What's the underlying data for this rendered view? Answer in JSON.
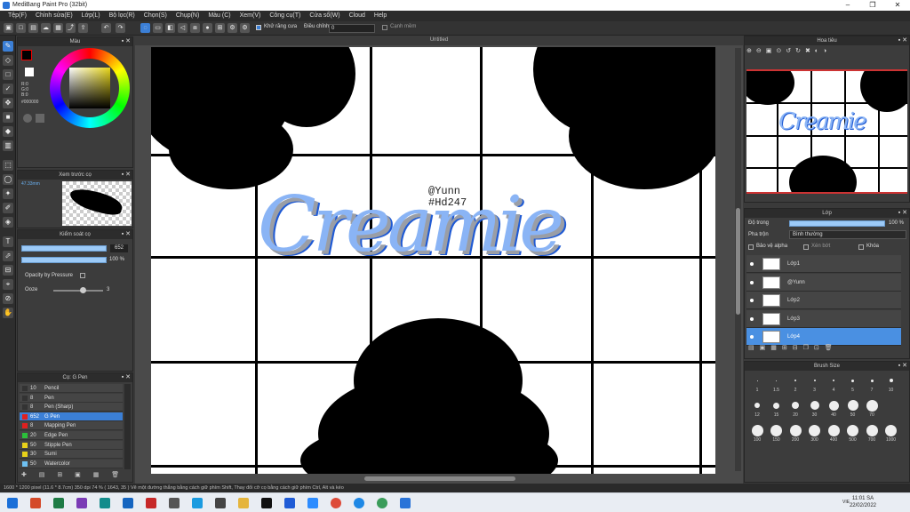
{
  "window": {
    "title": "MediBang Paint Pro (32bit)"
  },
  "menu": [
    "Tệp(F)",
    "Chỉnh sửa(E)",
    "Lớp(L)",
    "Bộ lọc(R)",
    "Chọn(S)",
    "Chụp(N)",
    "Màu (C)",
    "Xem(V)",
    "Công cụ(T)",
    "Cửa sổ(W)",
    "Cloud",
    "Help"
  ],
  "toolbar": {
    "antialias_label": "Khử răng cưa",
    "adjust_label": "Điều chỉnh",
    "adjust_value": "0",
    "edge_label": "Cạnh mềm"
  },
  "color_panel": {
    "title": "Màu",
    "r": "R:0",
    "g": "G:0",
    "b": "B:0",
    "hex": "#000000"
  },
  "brush_preview": {
    "title": "Xem trước cọ",
    "size": "47.33mm"
  },
  "brush_control": {
    "title": "Kiểm soát cọ",
    "size_value": "652",
    "opacity_value": "100 %",
    "opacity_by_pressure": "Opacity by Pressure",
    "ooze_label": "Ooze",
    "ooze_value": "3"
  },
  "brush_list": {
    "title": "Cọ: G Pen",
    "items": [
      {
        "size": "10",
        "name": "Pencil",
        "color": "#333333"
      },
      {
        "size": "8",
        "name": "Pen",
        "color": "#333333"
      },
      {
        "size": "8",
        "name": "Pen (Sharp)",
        "color": "#333333"
      },
      {
        "size": "652",
        "name": "G Pen",
        "color": "#e02020"
      },
      {
        "size": "8",
        "name": "Mapping Pen",
        "color": "#e02020"
      },
      {
        "size": "20",
        "name": "Edge Pen",
        "color": "#2bbf3a"
      },
      {
        "size": "50",
        "name": "Stipple Pen",
        "color": "#e8d21a"
      },
      {
        "size": "30",
        "name": "Sumi",
        "color": "#e8d21a"
      },
      {
        "size": "50",
        "name": "Watercolor",
        "color": "#6ec1f2"
      }
    ]
  },
  "document": {
    "tab": "Untitled",
    "title_text": "Creamie",
    "signature_line1": "@Yunn",
    "signature_line2": "#Hd247"
  },
  "navigator": {
    "title": "Hoa tiêu"
  },
  "layer_panel": {
    "title": "Lớp",
    "opacity_label": "Độ trong",
    "opacity_value": "100 %",
    "blend_label": "Pha trộn",
    "blend_value": "Bình thường",
    "protect_alpha": "Bảo vệ alpha",
    "clipping": "Xén bớt",
    "lock": "Khóa",
    "layers": [
      {
        "name": "Lớp1"
      },
      {
        "name": "@Yunn"
      },
      {
        "name": "Lớp2"
      },
      {
        "name": "Lớp3"
      },
      {
        "name": "Lớp4"
      }
    ]
  },
  "brush_size_panel": {
    "title": "Brush Size",
    "sizes": [
      "1",
      "1.5",
      "2",
      "3",
      "4",
      "5",
      "7",
      "10",
      "12",
      "15",
      "20",
      "30",
      "40",
      "50",
      "70",
      "100",
      "150",
      "200",
      "300",
      "400",
      "500",
      "700",
      "1000"
    ]
  },
  "status": {
    "text": "1600 * 1200 pixel   (11.6 * 8.7cm)   350 dpi   74 %   ( 1643, 35 )   Vẽ một đường thẳng bằng cách giữ phím Shift, Thay đổi cỡ cọ bằng cách giữ phím Ctrl, Alt và kéo"
  },
  "taskbar": {
    "time": "11:01 SA",
    "date": "22/02/2022",
    "lang": "VIE"
  }
}
